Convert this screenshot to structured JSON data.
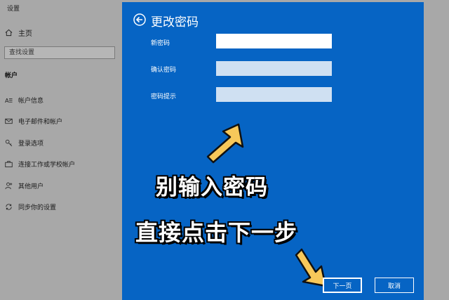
{
  "settings": {
    "window_title": "设置",
    "home_label": "主页",
    "search_placeholder": "查找设置",
    "section_label": "帐户",
    "nav_items": [
      {
        "label": "帐户信息",
        "icon": "person-card-icon"
      },
      {
        "label": "电子邮件和帐户",
        "icon": "mail-icon"
      },
      {
        "label": "登录选项",
        "icon": "key-icon"
      },
      {
        "label": "连接工作或学校帐户",
        "icon": "briefcase-icon"
      },
      {
        "label": "其他用户",
        "icon": "person-add-icon"
      },
      {
        "label": "同步你的设置",
        "icon": "sync-icon"
      }
    ]
  },
  "dialog": {
    "title": "更改密码",
    "fields": [
      {
        "label": "新密码",
        "value": ""
      },
      {
        "label": "确认密码",
        "value": ""
      },
      {
        "label": "密码提示",
        "value": ""
      }
    ],
    "next_button": "下一页",
    "cancel_button": "取消",
    "background_color": "#0664c4"
  },
  "overlay": {
    "line1": "别输入密码",
    "line2": "直接点击下一步",
    "arrow_color": "#f7c85a"
  }
}
